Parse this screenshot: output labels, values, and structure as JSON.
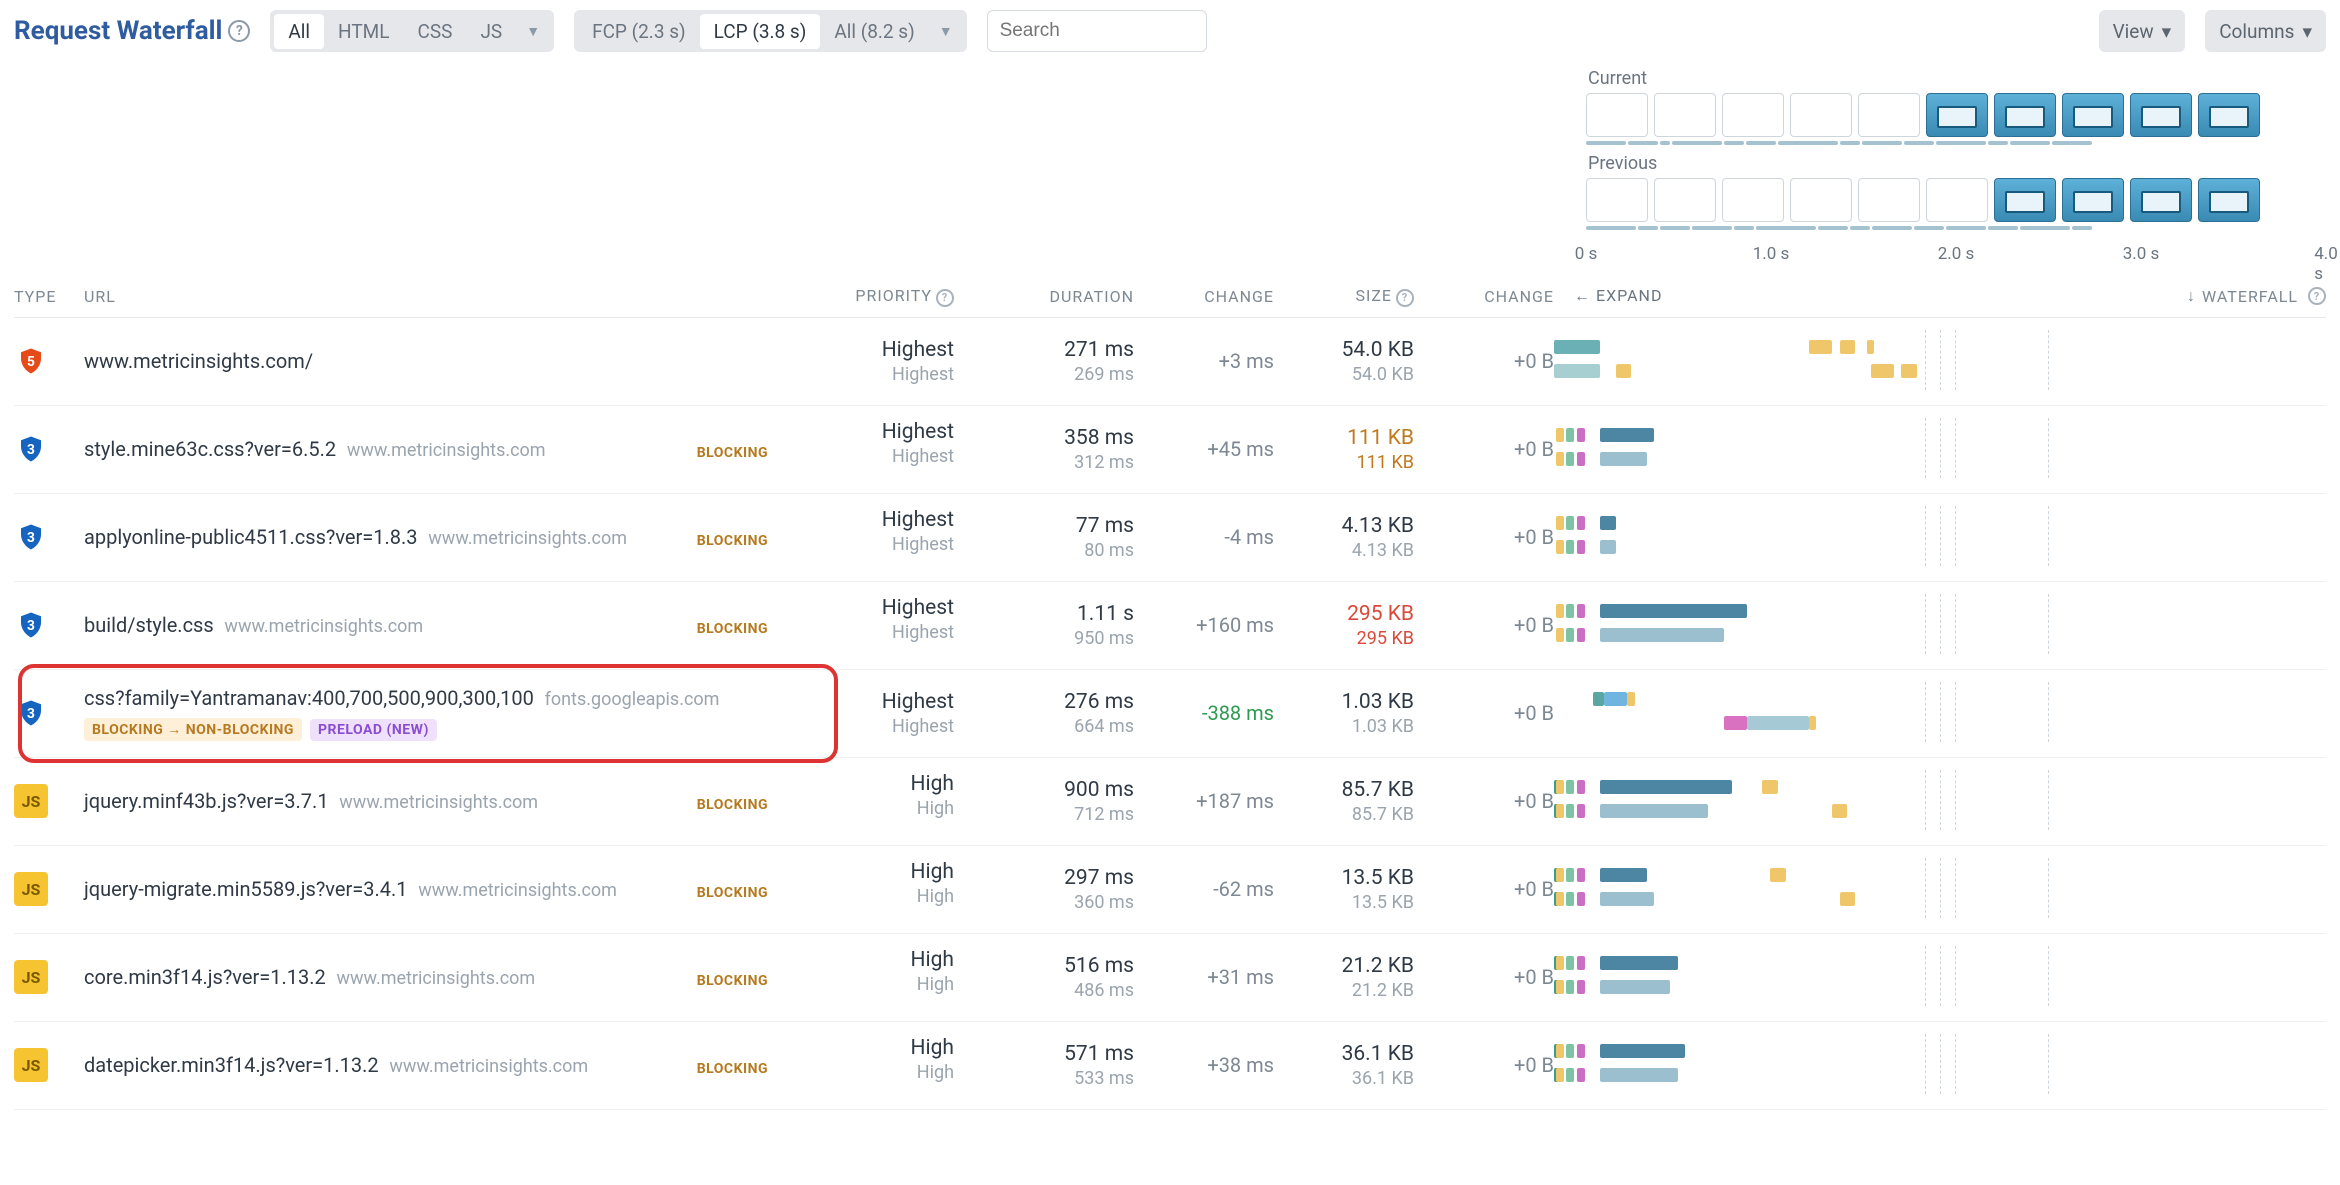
{
  "title": "Request Waterfall",
  "filters": {
    "type": {
      "items": [
        "All",
        "HTML",
        "CSS",
        "JS"
      ],
      "active": 0
    },
    "metric": {
      "items": [
        "FCP (2.3 s)",
        "LCP (3.8 s)",
        "All (8.2 s)"
      ],
      "active": 1
    },
    "search_placeholder": "Search"
  },
  "buttons": {
    "view": "View",
    "columns": "Columns"
  },
  "filmstrip": {
    "current_label": "Current",
    "previous_label": "Previous",
    "axis": [
      "0 s",
      "1.0 s",
      "2.0 s",
      "3.0 s",
      "4.0 s"
    ]
  },
  "columns": {
    "type": "TYPE",
    "url": "URL",
    "priority": "PRIORITY",
    "duration": "DURATION",
    "change": "CHANGE",
    "size": "SIZE",
    "change2": "CHANGE",
    "expand": "EXPAND",
    "waterfall": "WATERFALL"
  },
  "rows": [
    {
      "type": "html",
      "url": "www.metricinsights.com/",
      "host": "",
      "priority": "Highest",
      "priority2": "Highest",
      "duration": "271 ms",
      "duration2": "269 ms",
      "change": "+3 ms",
      "size": "54.0 KB",
      "size2": "54.0 KB",
      "change2": "+0 B",
      "wf": {
        "top": [
          {
            "l": 0,
            "w": 6,
            "c": "#6bb0b4"
          }
        ],
        "bot": [
          {
            "l": 0,
            "w": 6,
            "c": "#a7cfd1"
          },
          {
            "l": 8,
            "w": 2,
            "c": "#efc76a"
          }
        ],
        "extra": [
          {
            "row": "top",
            "l": 33,
            "w": 3,
            "c": "#efc76a"
          },
          {
            "row": "top",
            "l": 37,
            "w": 2,
            "c": "#efc76a"
          },
          {
            "row": "top",
            "l": 40.5,
            "w": 1,
            "c": "#efc76a"
          },
          {
            "row": "bot",
            "l": 41,
            "w": 3,
            "c": "#efc76a"
          },
          {
            "row": "bot",
            "l": 45,
            "w": 2,
            "c": "#efc76a"
          }
        ]
      }
    },
    {
      "type": "css",
      "url": "style.mine63c.css?ver=6.5.2",
      "host": "www.metricinsights.com",
      "badge": "BLOCKING",
      "priority": "Highest",
      "priority2": "Highest",
      "duration": "358 ms",
      "duration2": "312 ms",
      "change": "+45 ms",
      "size": "111 KB",
      "size2": "111 KB",
      "size_style": "warn",
      "change2": "+0 B",
      "wf": {
        "pre": true,
        "top": [
          {
            "l": 6,
            "w": 7,
            "c": "#4d86a3"
          }
        ],
        "bot": [
          {
            "l": 6,
            "w": 6,
            "c": "#9bbfcf"
          }
        ]
      }
    },
    {
      "type": "css",
      "url": "applyonline-public4511.css?ver=1.8.3",
      "host": "www.metricinsights.com",
      "badge": "BLOCKING",
      "priority": "Highest",
      "priority2": "Highest",
      "duration": "77 ms",
      "duration2": "80 ms",
      "change": "-4 ms",
      "size": "4.13 KB",
      "size2": "4.13 KB",
      "change2": "+0 B",
      "wf": {
        "pre": true,
        "top": [
          {
            "l": 6,
            "w": 2,
            "c": "#4d86a3"
          }
        ],
        "bot": [
          {
            "l": 6,
            "w": 2,
            "c": "#9bbfcf"
          }
        ]
      }
    },
    {
      "type": "css",
      "url": "build/style.css",
      "host": "www.metricinsights.com",
      "badge": "BLOCKING",
      "priority": "Highest",
      "priority2": "Highest",
      "duration": "1.11 s",
      "duration2": "950 ms",
      "change": "+160 ms",
      "size": "295 KB",
      "size2": "295 KB",
      "size_style": "bad",
      "change2": "+0 B",
      "wf": {
        "pre": true,
        "top": [
          {
            "l": 6,
            "w": 19,
            "c": "#4d86a3"
          }
        ],
        "bot": [
          {
            "l": 6,
            "w": 16,
            "c": "#9bbfcf"
          }
        ]
      }
    },
    {
      "type": "css",
      "url": "css?family=Yantramanav:400,700,500,900,300,100",
      "host": "fonts.googleapis.com",
      "badges": [
        {
          "text": "BLOCKING → NON-BLOCKING",
          "style": "nonblock"
        },
        {
          "text": "PRELOAD (NEW)",
          "style": "preload"
        }
      ],
      "priority": "Highest",
      "priority2": "Highest",
      "duration": "276 ms",
      "duration2": "664 ms",
      "change": "-388 ms",
      "change_style": "neg",
      "size": "1.03 KB",
      "size2": "1.03 KB",
      "change2": "+0 B",
      "wf": {
        "top": [
          {
            "l": 5,
            "w": 1.5,
            "c": "#59a6a2"
          },
          {
            "l": 6.5,
            "w": 3,
            "c": "#6fb5e0"
          },
          {
            "l": 9.5,
            "w": 1,
            "c": "#efc76a"
          }
        ],
        "bot": [
          {
            "l": 22,
            "w": 3,
            "c": "#d970c0"
          },
          {
            "l": 25,
            "w": 8,
            "c": "#a6c9d6"
          },
          {
            "l": 33,
            "w": 1,
            "c": "#efc76a"
          }
        ]
      },
      "highlight": true
    },
    {
      "type": "js",
      "url": "jquery.minf43b.js?ver=3.7.1",
      "host": "www.metricinsights.com",
      "badge": "BLOCKING",
      "priority": "High",
      "priority2": "High",
      "duration": "900 ms",
      "duration2": "712 ms",
      "change": "+187 ms",
      "size": "85.7 KB",
      "size2": "85.7 KB",
      "change2": "+0 B",
      "wf": {
        "pre": true,
        "dot": true,
        "top": [
          {
            "l": 6,
            "w": 17,
            "c": "#4d86a3"
          }
        ],
        "bot": [
          {
            "l": 6,
            "w": 14,
            "c": "#9bbfcf"
          }
        ],
        "extra": [
          {
            "row": "top",
            "l": 27,
            "w": 2,
            "c": "#efc76a"
          },
          {
            "row": "bot",
            "l": 36,
            "w": 2,
            "c": "#efc76a"
          }
        ]
      }
    },
    {
      "type": "js",
      "url": "jquery-migrate.min5589.js?ver=3.4.1",
      "host": "www.metricinsights.com",
      "badge": "BLOCKING",
      "priority": "High",
      "priority2": "High",
      "duration": "297 ms",
      "duration2": "360 ms",
      "change": "-62 ms",
      "size": "13.5 KB",
      "size2": "13.5 KB",
      "change2": "+0 B",
      "wf": {
        "pre": true,
        "dot": true,
        "top": [
          {
            "l": 6,
            "w": 6,
            "c": "#4d86a3"
          }
        ],
        "bot": [
          {
            "l": 6,
            "w": 7,
            "c": "#9bbfcf"
          }
        ],
        "extra": [
          {
            "row": "top",
            "l": 28,
            "w": 2,
            "c": "#efc76a"
          },
          {
            "row": "bot",
            "l": 37,
            "w": 2,
            "c": "#efc76a"
          }
        ]
      }
    },
    {
      "type": "js",
      "url": "core.min3f14.js?ver=1.13.2",
      "host": "www.metricinsights.com",
      "badge": "BLOCKING",
      "priority": "High",
      "priority2": "High",
      "duration": "516 ms",
      "duration2": "486 ms",
      "change": "+31 ms",
      "size": "21.2 KB",
      "size2": "21.2 KB",
      "change2": "+0 B",
      "wf": {
        "pre": true,
        "dot": true,
        "top": [
          {
            "l": 6,
            "w": 10,
            "c": "#4d86a3"
          }
        ],
        "bot": [
          {
            "l": 6,
            "w": 9,
            "c": "#9bbfcf"
          }
        ]
      }
    },
    {
      "type": "js",
      "url": "datepicker.min3f14.js?ver=1.13.2",
      "host": "www.metricinsights.com",
      "badge": "BLOCKING",
      "priority": "High",
      "priority2": "High",
      "duration": "571 ms",
      "duration2": "533 ms",
      "change": "+38 ms",
      "size": "36.1 KB",
      "size2": "36.1 KB",
      "change2": "+0 B",
      "wf": {
        "pre": true,
        "dot": true,
        "top": [
          {
            "l": 6,
            "w": 11,
            "c": "#4d86a3"
          }
        ],
        "bot": [
          {
            "l": 6,
            "w": 10,
            "c": "#9bbfcf"
          }
        ]
      }
    }
  ]
}
